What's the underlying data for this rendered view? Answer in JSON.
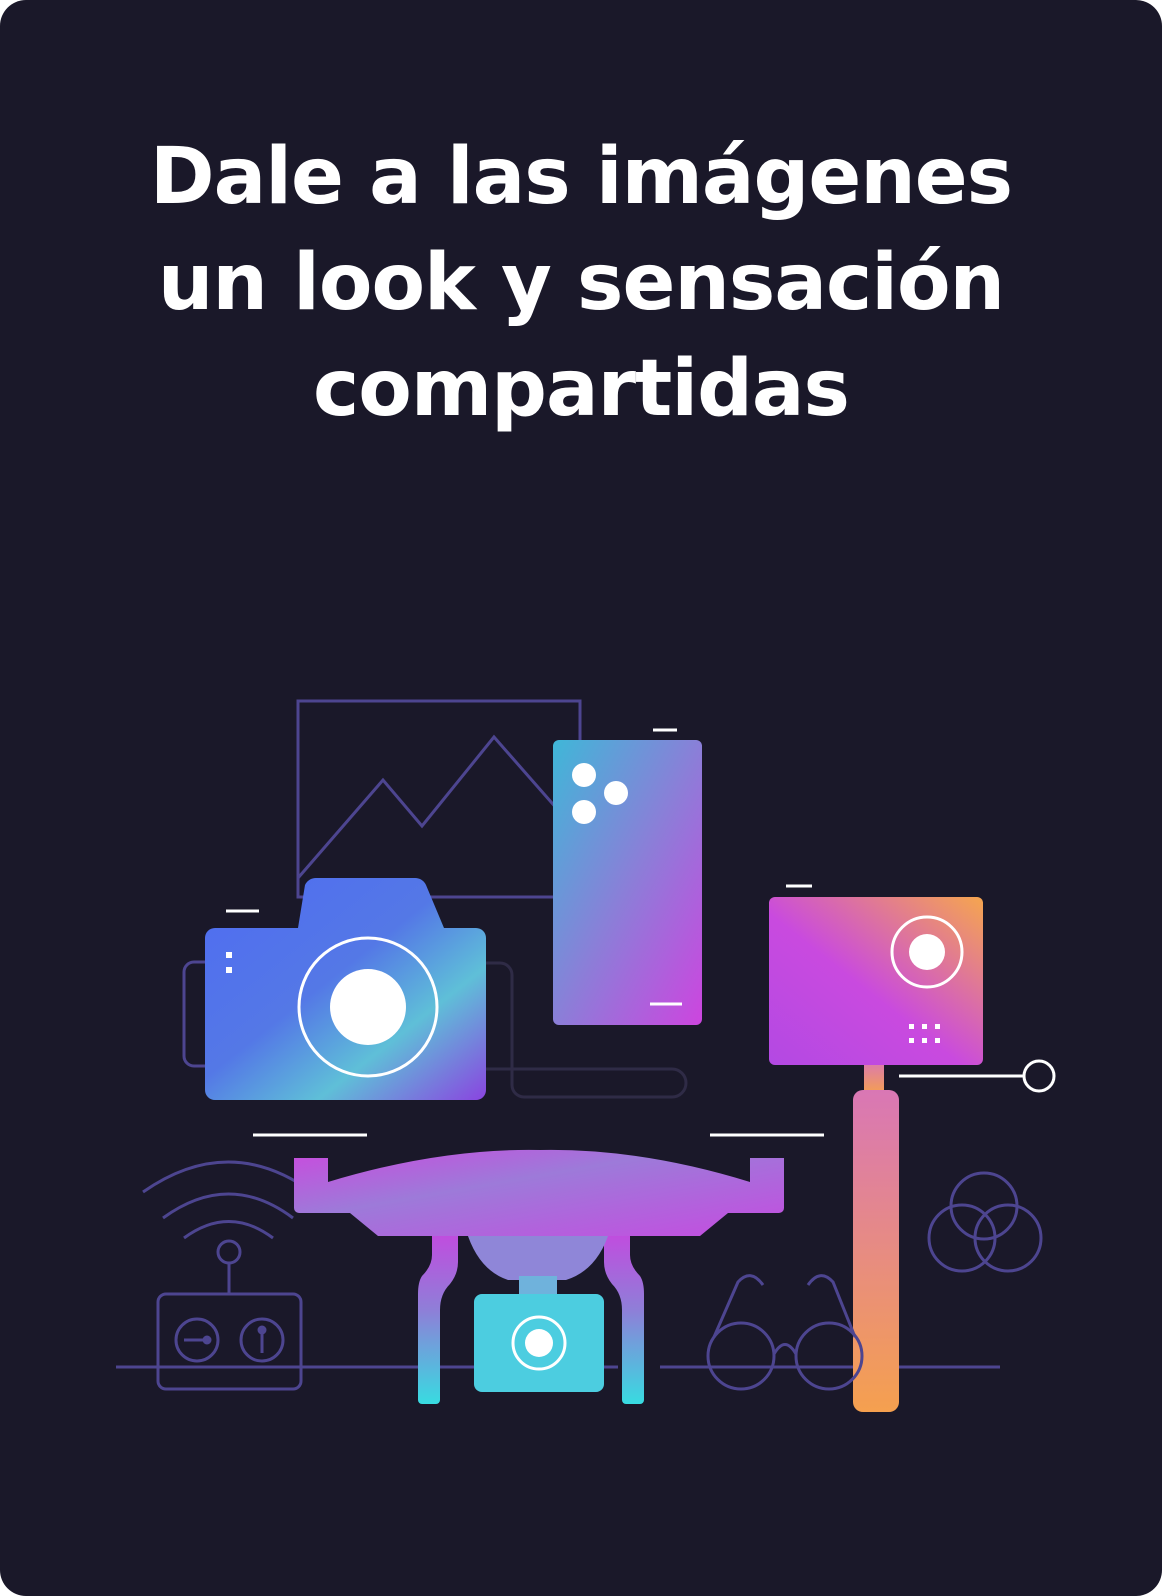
{
  "headline": {
    "lines": [
      "Dale a las imágenes",
      "un look y sensación",
      "compartidas"
    ]
  },
  "illustration": {
    "icons": [
      "picture-frame-icon",
      "photo-camera-icon",
      "smartphone-icon",
      "action-camera-icon",
      "selfie-stick-icon",
      "drone-icon",
      "remote-control-icon",
      "wifi-signal-icon",
      "glasses-icon",
      "color-circles-icon"
    ]
  },
  "colors": {
    "background": "#1a1829",
    "text": "#ffffff",
    "outline": "#4d4590",
    "gradient_blue": "#4f6cf2",
    "gradient_purple": "#c14be0",
    "gradient_cyan": "#38dbe1",
    "gradient_orange": "#f4a553"
  }
}
